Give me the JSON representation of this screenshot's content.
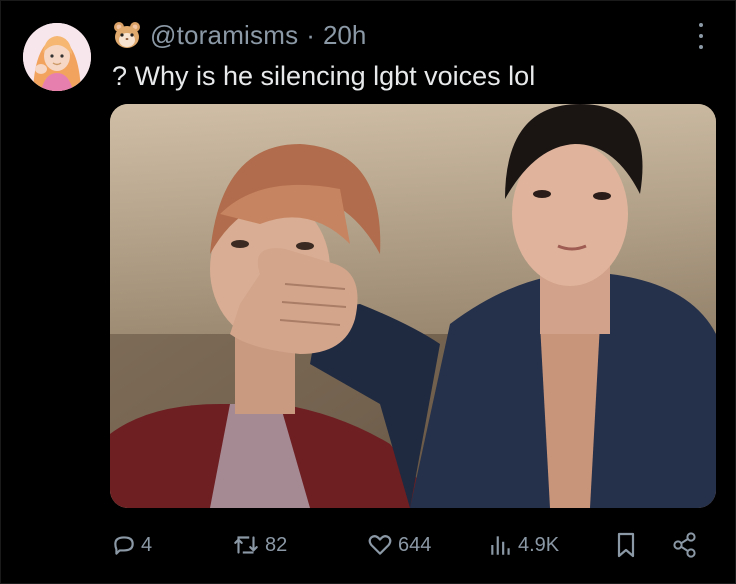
{
  "tweet": {
    "handle": "@toramisms",
    "separator": "·",
    "time": "20h",
    "text": "? Why is he silencing lgbt voices lol",
    "badge_icon": "hamster-icon",
    "avatar_icon": "avatar"
  },
  "actions": {
    "replies": "4",
    "reposts": "82",
    "likes": "644",
    "views": "4.9K",
    "icons": [
      "reply-icon",
      "repost-icon",
      "like-icon",
      "views-icon",
      "bookmark-icon",
      "share-icon"
    ]
  },
  "colors": {
    "background": "#000000",
    "text": "#e7e9ea",
    "muted": "#8b98a5"
  }
}
